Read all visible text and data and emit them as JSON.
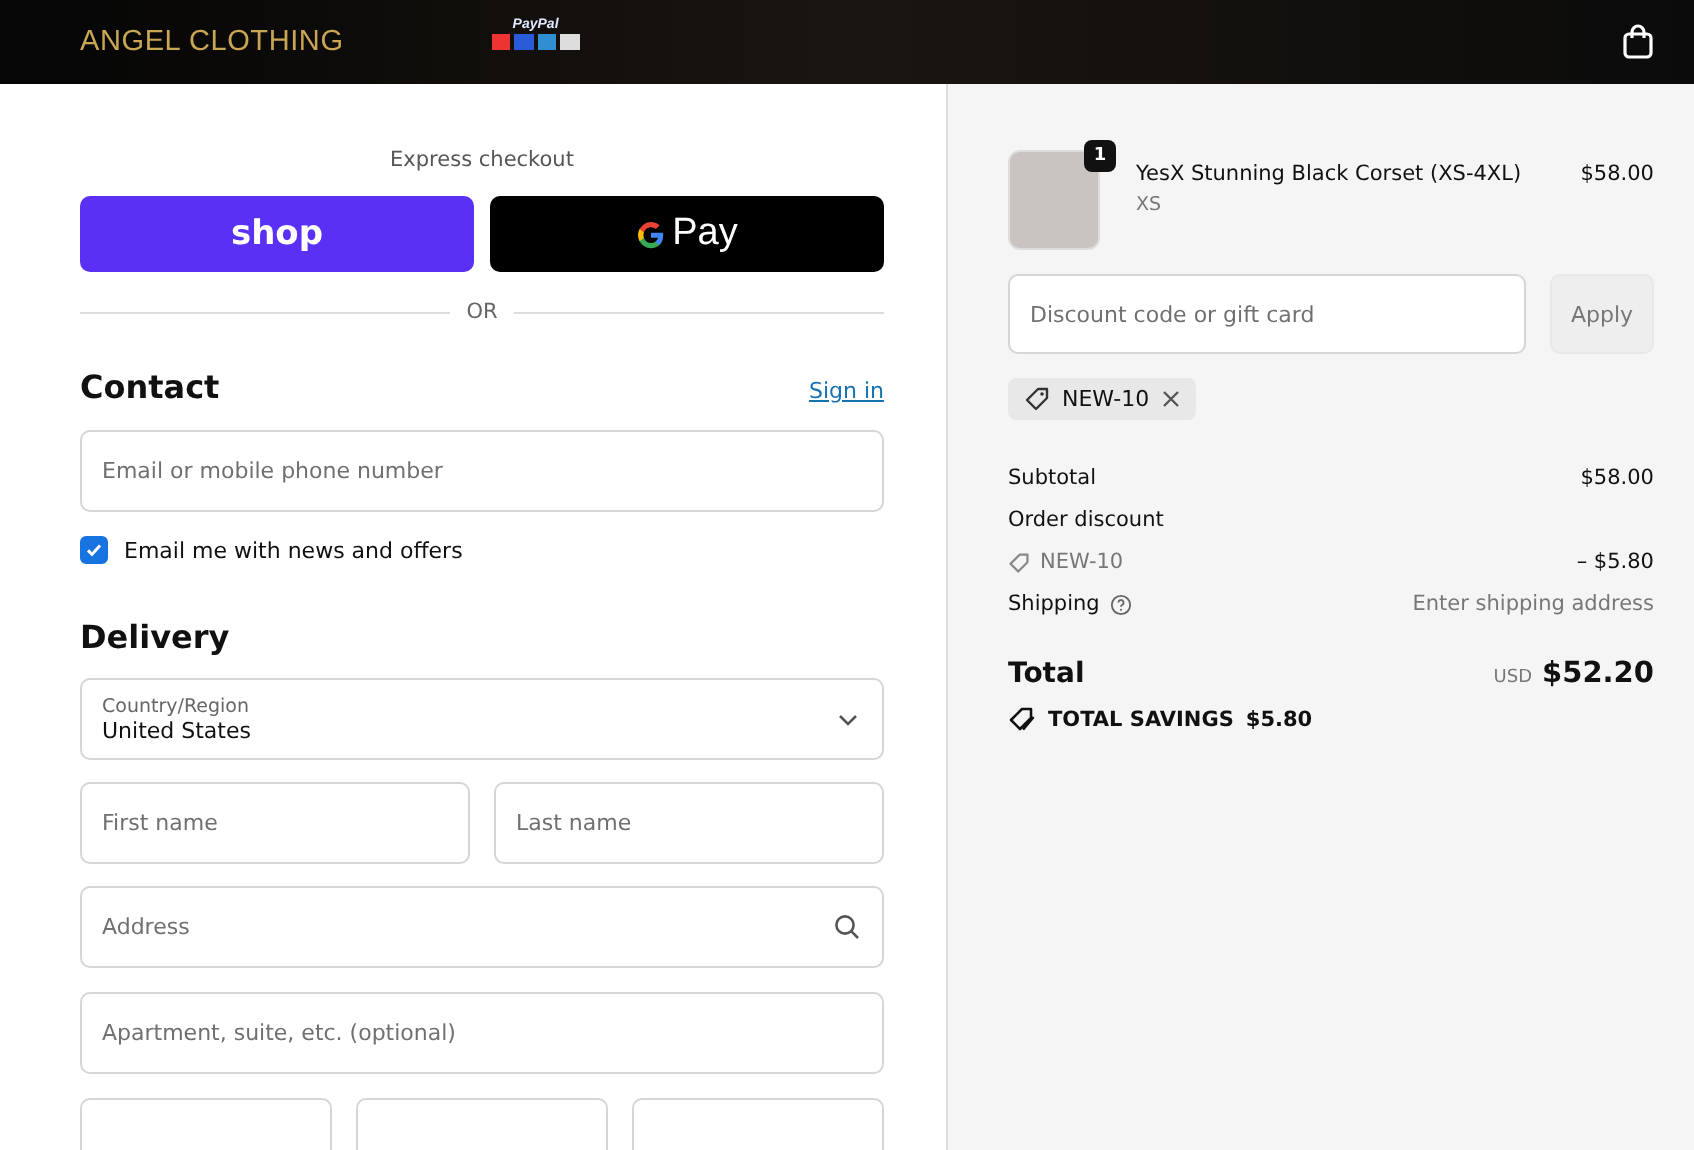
{
  "header": {
    "logo": "ANGEL CLOTHING",
    "paypal": "PayPal"
  },
  "express": {
    "title": "Express checkout",
    "shop": "shop",
    "gpay": "Pay",
    "divider": "OR"
  },
  "contact": {
    "heading": "Contact",
    "sign_in": "Sign in",
    "email_placeholder": "Email or mobile phone number",
    "newsletter": {
      "label": "Email me with news and offers",
      "checked": true
    }
  },
  "delivery": {
    "heading": "Delivery",
    "country_label": "Country/Region",
    "country": "United States",
    "first_name_placeholder": "First name",
    "last_name_placeholder": "Last name",
    "address_placeholder": "Address",
    "apartment_placeholder": "Apartment, suite, etc. (optional)"
  },
  "summary": {
    "item": {
      "name": "YesX Stunning Black Corset (XS-4XL)",
      "variant": "XS",
      "price": "$58.00",
      "quantity": "1"
    },
    "discount_placeholder": "Discount code or gift card",
    "apply": "Apply",
    "applied_code": "NEW-10",
    "subtotal_label": "Subtotal",
    "subtotal": "$58.00",
    "order_discount_label": "Order discount",
    "discount_code": "NEW-10",
    "discount": "– $5.80",
    "shipping_label": "Shipping",
    "shipping": "Enter shipping address",
    "total_label": "Total",
    "currency": "USD",
    "total": "$52.20",
    "savings_label": "TOTAL SAVINGS",
    "savings": "$5.80"
  }
}
